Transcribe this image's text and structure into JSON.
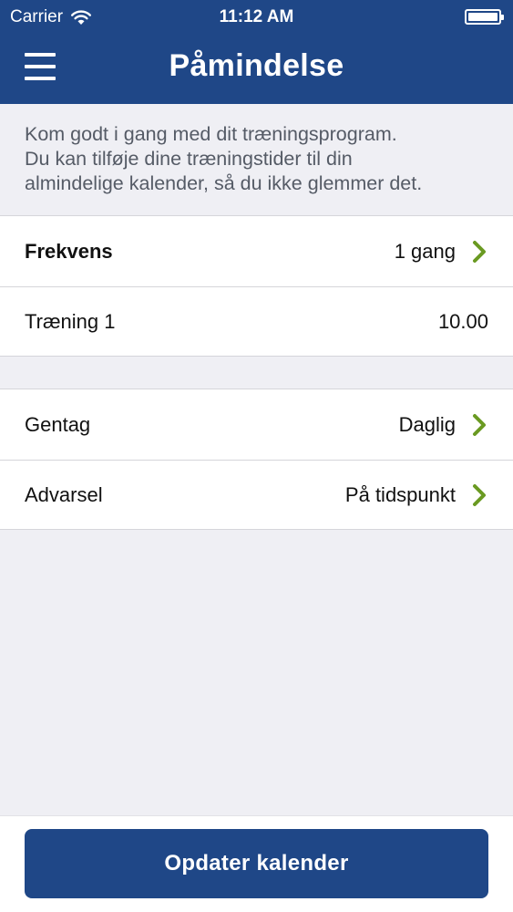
{
  "status_bar": {
    "carrier": "Carrier",
    "time": "11:12 AM",
    "icons": [
      "wifi-icon",
      "battery-icon"
    ]
  },
  "nav": {
    "menu_icon": "menu-icon",
    "title": "Påmindelse"
  },
  "intro": {
    "line1": "Kom godt i gang med dit træningsprogram.",
    "line2": "Du kan tilføje dine træningstider til din",
    "line3": "almindelige kalender, så du ikke glemmer det."
  },
  "groups": [
    {
      "rows": [
        {
          "label": "Frekvens",
          "value": "1 gang",
          "chevron": true,
          "bold": true
        },
        {
          "label": "Træning 1",
          "value": "10.00",
          "chevron": false,
          "bold": false
        }
      ]
    },
    {
      "rows": [
        {
          "label": "Gentag",
          "value": "Daglig",
          "chevron": true,
          "bold": false
        },
        {
          "label": "Advarsel",
          "value": "På tidspunkt",
          "chevron": true,
          "bold": false
        }
      ]
    }
  ],
  "footer": {
    "button_label": "Opdater kalender"
  },
  "colors": {
    "brand": "#1f4787",
    "chevron": "#6a9a22",
    "background": "#efeff4"
  }
}
